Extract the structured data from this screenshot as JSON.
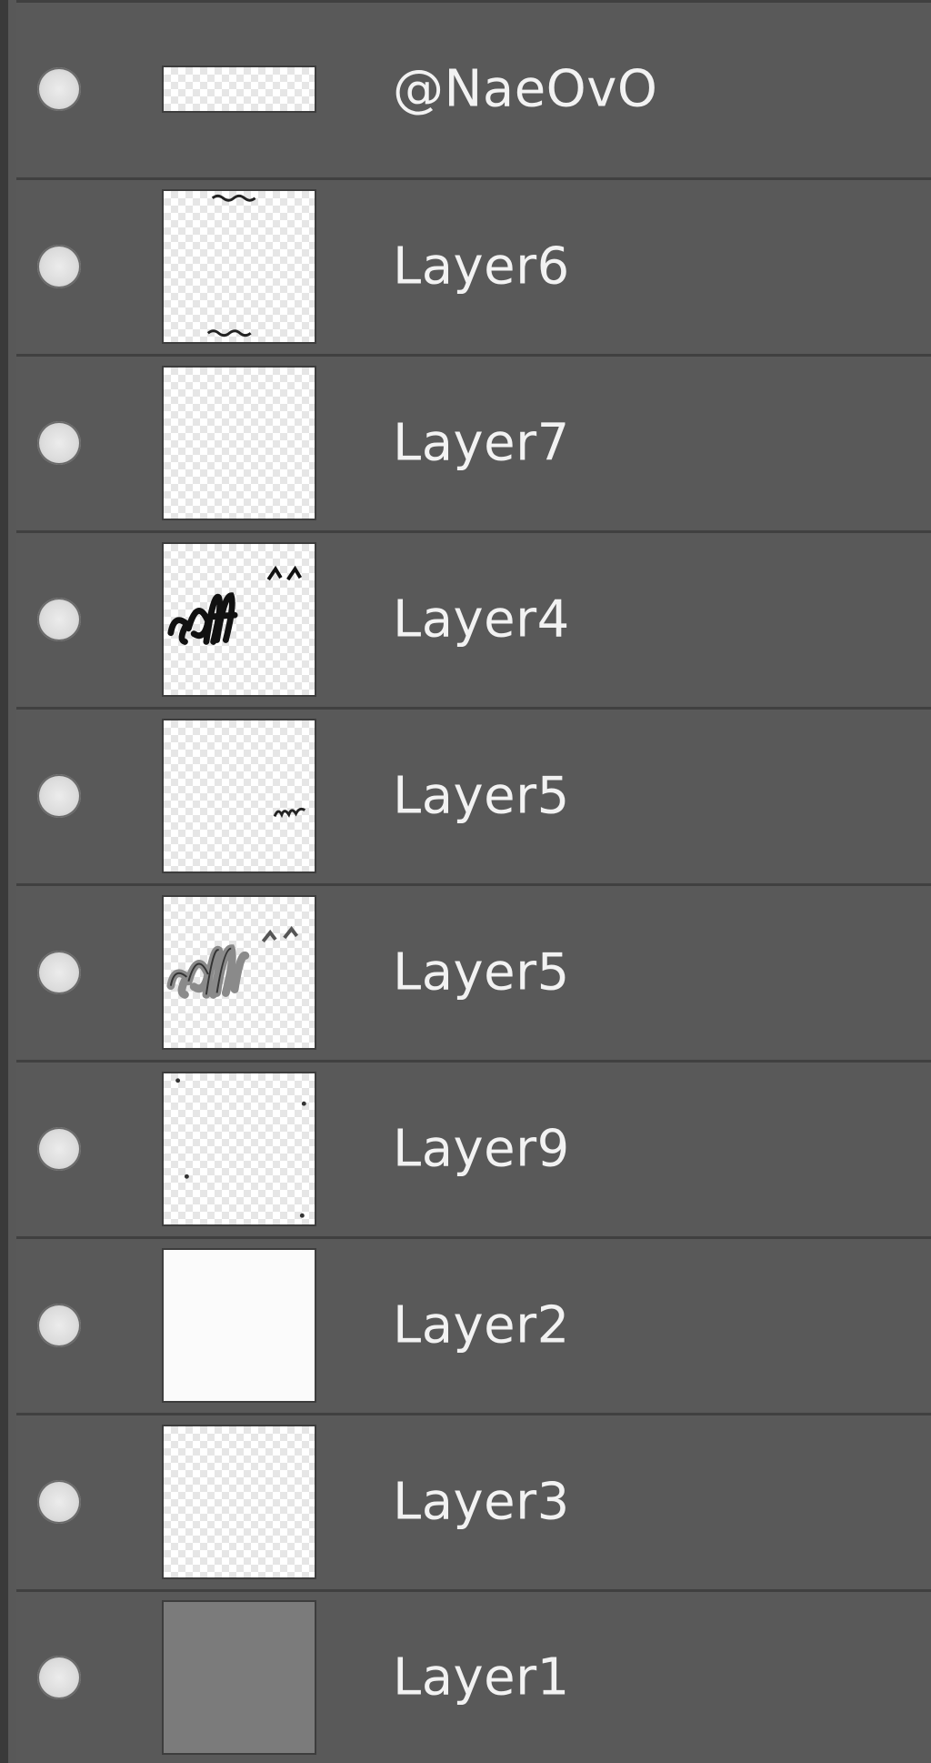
{
  "layers_panel": {
    "layers": [
      {
        "name": "@NaeOvO",
        "thumbnail": "text-layer-thumb",
        "visible": true
      },
      {
        "name": "Layer6",
        "thumbnail": "small-marks-thumb",
        "visible": true
      },
      {
        "name": "Layer7",
        "thumbnail": "empty-thumb",
        "visible": true
      },
      {
        "name": "Layer4",
        "thumbnail": "lettering-black-thumb",
        "visible": true
      },
      {
        "name": "Layer5",
        "thumbnail": "small-lettering-thumb",
        "visible": true
      },
      {
        "name": "Layer5",
        "thumbnail": "lettering-gray-thumb",
        "visible": true
      },
      {
        "name": "Layer9",
        "thumbnail": "dots-thumb",
        "visible": true
      },
      {
        "name": "Layer2",
        "thumbnail": "white-thumb",
        "visible": true
      },
      {
        "name": "Layer3",
        "thumbnail": "empty-thumb",
        "visible": true
      },
      {
        "name": "Layer1",
        "thumbnail": "gray-fill-thumb",
        "visible": true
      }
    ]
  },
  "colors": {
    "panel_background": "#595959",
    "row_divider": "#404040",
    "text": "#f2f2f2",
    "layer1_fill": "#7b7b7b"
  }
}
